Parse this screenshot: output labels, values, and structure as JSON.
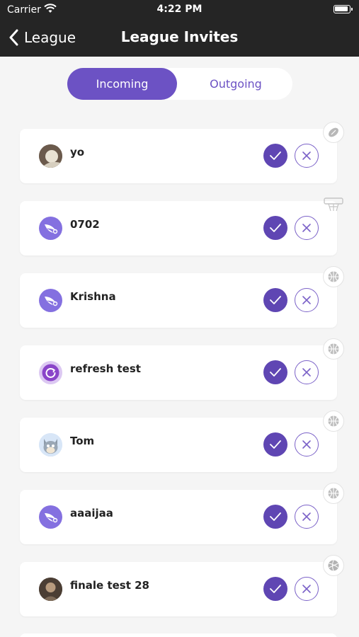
{
  "status_bar": {
    "carrier": "Carrier",
    "time": "4:22 PM"
  },
  "nav": {
    "back_label": "League",
    "title": "League Invites"
  },
  "tabs": [
    {
      "label": "Incoming",
      "active": true
    },
    {
      "label": "Outgoing",
      "active": false
    }
  ],
  "invites": [
    {
      "name": "yo",
      "avatar": "photo-avatar",
      "sport_icon": "football-icon"
    },
    {
      "name": "0702",
      "avatar": "wing-avatar",
      "sport_icon": "basketball-hoop-icon"
    },
    {
      "name": "Krishna",
      "avatar": "wing-avatar",
      "sport_icon": "basketball-icon"
    },
    {
      "name": "refresh test",
      "avatar": "refresh-avatar",
      "sport_icon": "basketball-icon"
    },
    {
      "name": "Tom",
      "avatar": "cartoon-avatar",
      "sport_icon": "basketball-icon"
    },
    {
      "name": "aaaijaa",
      "avatar": "wing-avatar",
      "sport_icon": "basketball-icon"
    },
    {
      "name": "finale test 28",
      "avatar": "photo-avatar",
      "sport_icon": "volleyball-icon"
    }
  ],
  "colors": {
    "accent": "#6c52c4",
    "header": "#252525",
    "background": "#f5f5f5"
  }
}
